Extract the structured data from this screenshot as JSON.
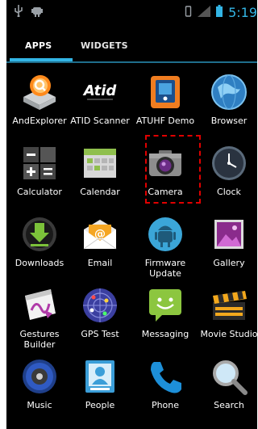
{
  "status_bar": {
    "time": "5:19"
  },
  "tabs": {
    "apps": "APPS",
    "widgets": "WIDGETS"
  },
  "apps": [
    {
      "label": "AndExplorer",
      "icon": "andexplorer-icon"
    },
    {
      "label": "ATID Scanner",
      "icon": "atid-scanner-icon",
      "icon_text": "Atid"
    },
    {
      "label": "ATUHF Demo",
      "icon": "atuhf-demo-icon"
    },
    {
      "label": "Browser",
      "icon": "browser-icon"
    },
    {
      "label": "Calculator",
      "icon": "calculator-icon"
    },
    {
      "label": "Calendar",
      "icon": "calendar-icon"
    },
    {
      "label": "Camera",
      "icon": "camera-icon"
    },
    {
      "label": "Clock",
      "icon": "clock-icon"
    },
    {
      "label": "Downloads",
      "icon": "downloads-icon"
    },
    {
      "label": "Email",
      "icon": "email-icon"
    },
    {
      "label": "Firmware\nUpdate",
      "icon": "firmware-update-icon"
    },
    {
      "label": "Gallery",
      "icon": "gallery-icon"
    },
    {
      "label": "Gestures\nBuilder",
      "icon": "gestures-builder-icon"
    },
    {
      "label": "GPS Test",
      "icon": "gps-test-icon"
    },
    {
      "label": "Messaging",
      "icon": "messaging-icon"
    },
    {
      "label": "Movie Studio",
      "icon": "movie-studio-icon"
    },
    {
      "label": "Music",
      "icon": "music-icon"
    },
    {
      "label": "People",
      "icon": "people-icon"
    },
    {
      "label": "Phone",
      "icon": "phone-icon"
    },
    {
      "label": "Search",
      "icon": "search-icon"
    }
  ],
  "colors": {
    "accent": "#33b5e5",
    "highlight_border": "#e00000",
    "background": "#000000"
  }
}
